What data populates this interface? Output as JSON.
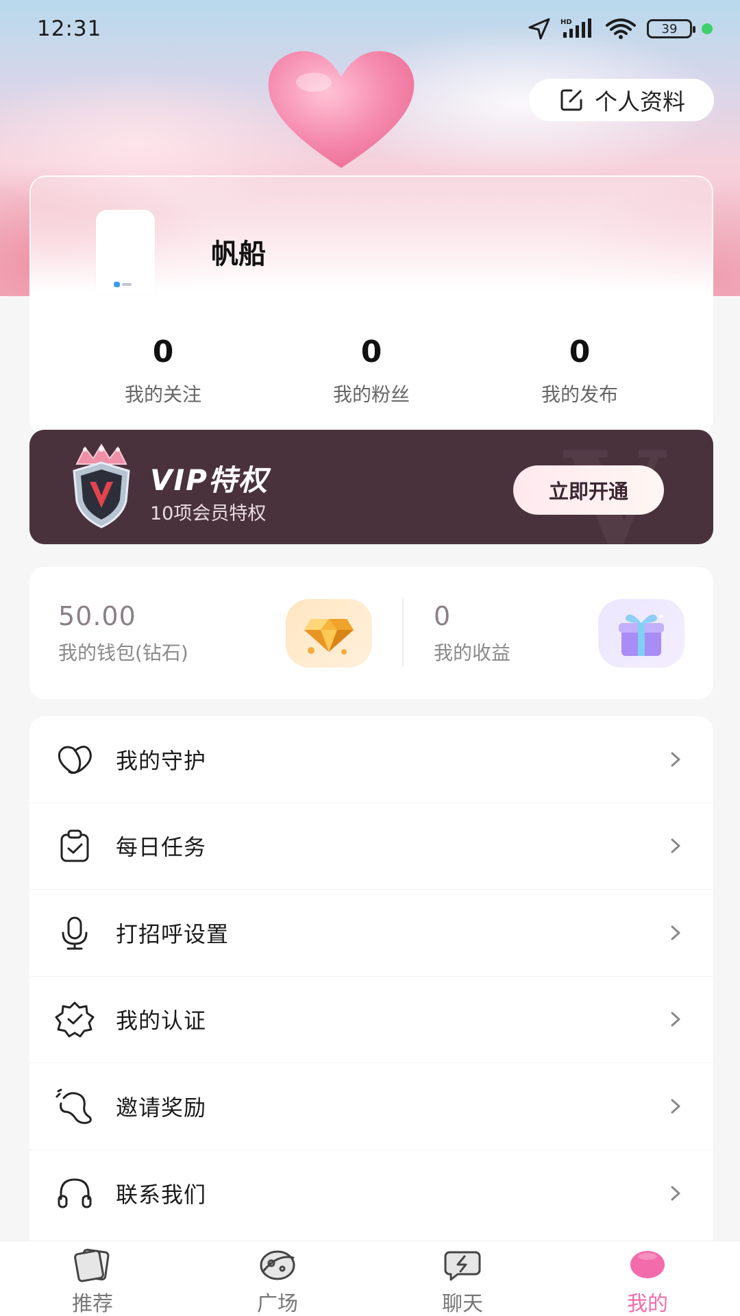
{
  "status_bar": {
    "time": "12:31",
    "battery": "39",
    "icons": [
      "location-arrow-icon",
      "hd-signal-icon",
      "wifi-icon",
      "battery-icon"
    ]
  },
  "header": {
    "edit_profile_label": "个人资料"
  },
  "profile": {
    "username": "帆船",
    "stats": [
      {
        "value": "0",
        "label": "我的关注"
      },
      {
        "value": "0",
        "label": "我的粉丝"
      },
      {
        "value": "0",
        "label": "我的发布"
      }
    ]
  },
  "vip": {
    "title": "VIP特权",
    "subtitle": "10项会员特权",
    "button_label": "立即开通",
    "watermark": "V"
  },
  "wallet": {
    "diamond_value": "50.00",
    "diamond_label": "我的钱包(钻石)",
    "earnings_value": "0",
    "earnings_label": "我的收益"
  },
  "menu": [
    {
      "label": "我的守护",
      "icon": "heart-guard-icon"
    },
    {
      "label": "每日任务",
      "icon": "clipboard-check-icon"
    },
    {
      "label": "打招呼设置",
      "icon": "microphone-icon"
    },
    {
      "label": "我的认证",
      "icon": "verified-badge-icon"
    },
    {
      "label": "邀请奖励",
      "icon": "invite-swirl-icon"
    },
    {
      "label": "联系我们",
      "icon": "headset-icon"
    }
  ],
  "bottom_nav": [
    {
      "label": "推荐",
      "icon": "cards-icon",
      "active": false
    },
    {
      "label": "广场",
      "icon": "planet-icon",
      "active": false
    },
    {
      "label": "聊天",
      "icon": "chat-bolt-icon",
      "active": false
    },
    {
      "label": "我的",
      "icon": "profile-blob-icon",
      "active": true
    }
  ],
  "colors": {
    "accent_pink": "#f36bab",
    "vip_background": "#4a323d",
    "status_dot": "#3ed06b"
  }
}
